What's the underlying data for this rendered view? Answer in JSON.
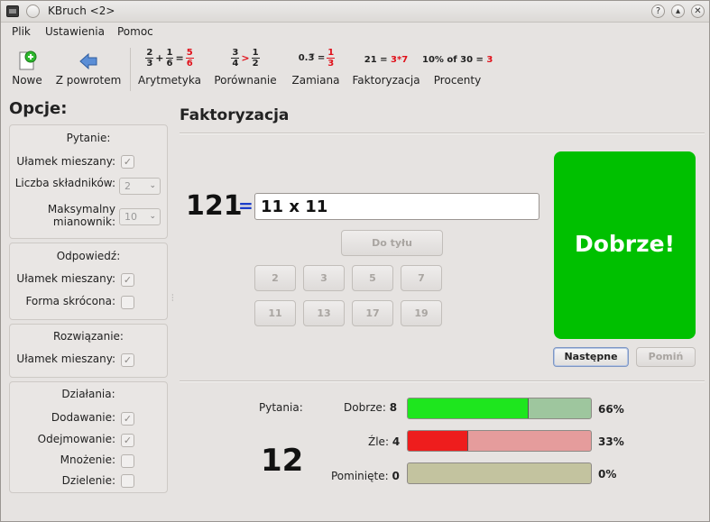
{
  "window": {
    "title": "KBruch <2>"
  },
  "menu": [
    "Plik",
    "Ustawienia",
    "Pomoc"
  ],
  "toolbar": {
    "new_label": "Nowe",
    "back_label": "Z powrotem",
    "arithmetic_label": "Arytmetyka",
    "arithmetic_icon": {
      "a_num": "2",
      "a_den": "3",
      "op": "+",
      "b_num": "1",
      "b_den": "6",
      "eq": "=",
      "r_num": "5",
      "r_den": "6"
    },
    "comparison_label": "Porównanie",
    "comparison_icon": {
      "a_num": "3",
      "a_den": "4",
      "op": ">",
      "b_num": "1",
      "b_den": "2"
    },
    "conversion_label": "Zamiana",
    "conversion_icon": {
      "left": "0.3̅ =",
      "r_num": "1",
      "r_den": "3"
    },
    "factorization_label": "Faktoryzacja",
    "factorization_icon": {
      "left": "21 =",
      "right": "3*7"
    },
    "percent_label": "Procenty",
    "percent_icon": {
      "left": "10% of 30 =",
      "right": "3"
    }
  },
  "options": {
    "title": "Opcje:",
    "question": {
      "title": "Pytanie:",
      "mixed_label": "Ułamek mieszany:",
      "terms_label": "Liczba składników:",
      "terms_value": "2",
      "max_denom_label_1": "Maksymalny",
      "max_denom_label_2": "mianownik:",
      "max_denom_value": "10"
    },
    "answer": {
      "title": "Odpowiedź:",
      "mixed_label": "Ułamek mieszany:",
      "reduced_label": "Forma skrócona:"
    },
    "solution": {
      "title": "Rozwiązanie:",
      "mixed_label": "Ułamek mieszany:"
    },
    "operations": {
      "title": "Działania:",
      "add_label": "Dodawanie:",
      "sub_label": "Odejmowanie:",
      "mul_label": "Mnożenie:",
      "div_label": "Dzielenie:"
    }
  },
  "main": {
    "title": "Faktoryzacja",
    "number": "121",
    "equals": "=",
    "answer_value": "11 x 11",
    "backspace_label": "Do tyłu",
    "factor_buttons": [
      "2",
      "3",
      "5",
      "7",
      "11",
      "13",
      "17",
      "19"
    ],
    "result_text": "Dobrze!",
    "next_label": "Następne",
    "skip_label": "Pomiń"
  },
  "stats": {
    "questions_label": "Pytania:",
    "questions_count": "12",
    "correct_label": "Dobrze:",
    "correct_count": "8",
    "correct_pct": "66%",
    "correct_fraction": 0.66,
    "wrong_label": "Źle:",
    "wrong_count": "4",
    "wrong_pct": "33%",
    "wrong_fraction": 0.33,
    "skipped_label": "Pominięte:",
    "skipped_count": "0",
    "skipped_pct": "0%",
    "skipped_fraction": 0
  },
  "colors": {
    "result_bg": "#00c000",
    "correct_fill": "#1ee61e",
    "correct_track": "#9ec69e",
    "wrong_fill": "#ee1d1d",
    "wrong_track": "#e59c9c",
    "skipped_track": "#c3c39f",
    "equals_blue": "#1d3ec9",
    "accent_red": "#e0101a"
  }
}
